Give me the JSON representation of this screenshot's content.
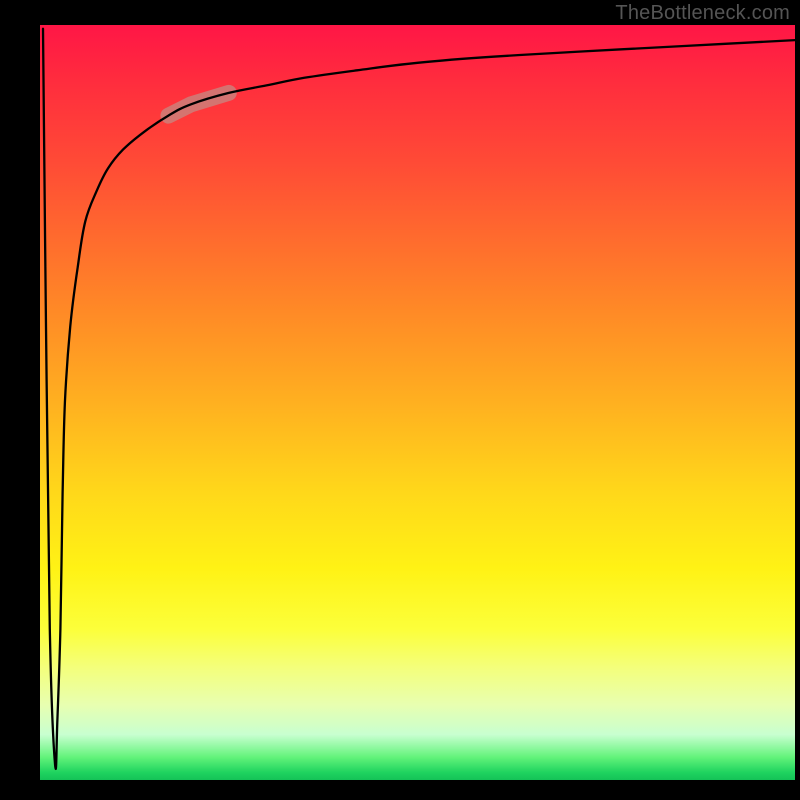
{
  "watermark": "TheBottleneck.com",
  "chart_data": {
    "type": "line",
    "title": "",
    "xlabel": "",
    "ylabel": "",
    "xlim": [
      0,
      100
    ],
    "ylim": [
      0,
      100
    ],
    "grid": false,
    "series": [
      {
        "name": "bottleneck-curve",
        "x": [
          0.4,
          0.8,
          1.3,
          2.0,
          2.3,
          2.7,
          3.0,
          3.3,
          4.0,
          5.0,
          6.0,
          7.5,
          9.0,
          11,
          14,
          17,
          20,
          25,
          30,
          35,
          42,
          50,
          60,
          72,
          85,
          100
        ],
        "y": [
          99.5,
          60,
          20,
          2,
          8,
          20,
          38,
          50,
          60,
          68,
          74,
          78,
          81,
          83.5,
          86,
          88,
          89.5,
          91,
          92,
          93,
          94,
          95,
          95.8,
          96.5,
          97.2,
          98
        ]
      }
    ],
    "highlight_segment": {
      "x_start": 17,
      "x_end": 25
    },
    "annotations": []
  },
  "colors": {
    "gradient_top": "#ff1646",
    "gradient_bottom": "#14c257",
    "curve": "#000000",
    "highlight": "#c68a83",
    "frame": "#000000",
    "watermark": "#555555"
  }
}
